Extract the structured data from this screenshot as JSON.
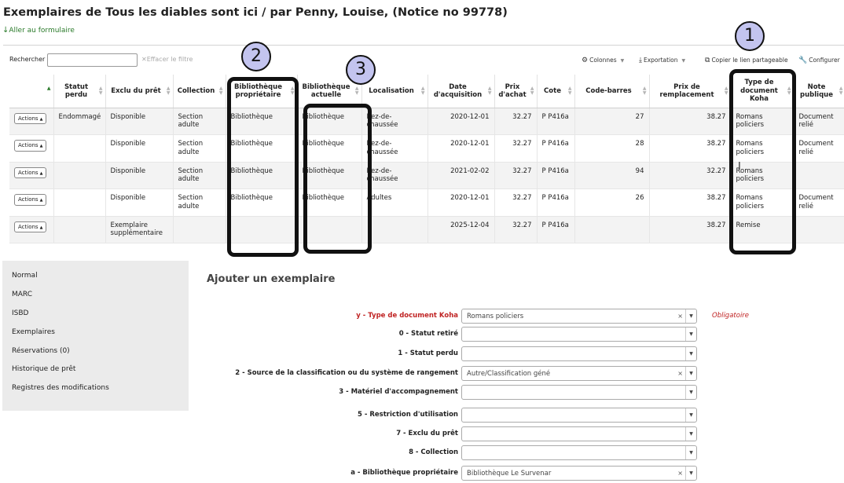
{
  "page_title": "Exemplaires de Tous les diables sont ici / par Penny, Louise, (Notice no 99778)",
  "goto_form": "Aller au formulaire",
  "toolbar": {
    "search_label": "Rechercher :",
    "search_value": "",
    "clear_filter": "Effacer le filtre",
    "columns": "Colonnes",
    "export": "Exportation",
    "copy_link": "Copier le lien partageable",
    "configure": "Configurer"
  },
  "table": {
    "headers": [
      "",
      "Statut perdu",
      "Exclu du prêt",
      "Collection",
      "Bibliothèque propriétaire",
      "Bibliothèque actuelle",
      "Localisation",
      "Date d'acquisition",
      "Prix d'achat",
      "Cote",
      "Code-barres",
      "Prix de remplacement",
      "Type de document Koha",
      "Note publique"
    ],
    "action_label": "Actions",
    "rows": [
      {
        "lost": "Endommagé",
        "notforloan": "Disponible",
        "collection": "Section adulte",
        "homebranch": "Bibliothèque",
        "holdingbranch": "Bibliothèque",
        "location": "Rez-de-chaussée",
        "date": "2020-12-01",
        "price": "32.27",
        "callnumber": "P P416a",
        "barcode": "27",
        "replacement": "38.27",
        "itype": "Romans policiers",
        "note": "Document relié"
      },
      {
        "lost": "",
        "notforloan": "Disponible",
        "collection": "Section adulte",
        "homebranch": "Bibliothèque",
        "holdingbranch": "Bibliothèque",
        "location": "Rez-de-chaussée",
        "date": "2020-12-01",
        "price": "32.27",
        "callnumber": "P P416a",
        "barcode": "28",
        "replacement": "38.27",
        "itype": "Romans policiers",
        "note": "Document relié"
      },
      {
        "lost": "",
        "notforloan": "Disponible",
        "collection": "Section adulte",
        "homebranch": "Bibliothèque",
        "holdingbranch": "Bibliothèque",
        "location": "Rez-de-chaussée",
        "date": "2021-02-02",
        "price": "32.27",
        "callnumber": "P P416a",
        "barcode": "94",
        "replacement": "32.27",
        "itype": "Romans policiers",
        "note": ""
      },
      {
        "lost": "",
        "notforloan": "Disponible",
        "collection": "Section adulte",
        "homebranch": "Bibliothèque",
        "holdingbranch": "Bibliothèque",
        "location": "Adultes",
        "date": "2020-12-01",
        "price": "32.27",
        "callnumber": "P P416a",
        "barcode": "26",
        "replacement": "38.27",
        "itype": "Romans policiers",
        "note": "Document relié"
      },
      {
        "lost": "",
        "notforloan": "Exemplaire supplémentaire",
        "collection": "",
        "homebranch": "",
        "holdingbranch": "",
        "location": "",
        "date": "2025-12-04",
        "price": "32.27",
        "callnumber": "P P416a",
        "barcode": "",
        "replacement": "38.27",
        "itype": "Remise",
        "note": ""
      }
    ]
  },
  "callouts": [
    "1",
    "2",
    "3"
  ],
  "side_menu": [
    "Normal",
    "MARC",
    "ISBD",
    "Exemplaires",
    "Réservations (0)",
    "Historique de prêt",
    "Registres des modifications"
  ],
  "form": {
    "title": "Ajouter un exemplaire",
    "mandatory_label": "Obligatoire",
    "fields": [
      {
        "label": "y - Type de document Koha",
        "value": "Romans policiers",
        "required": true
      },
      {
        "label": "0 - Statut retiré",
        "value": "",
        "required": false
      },
      {
        "label": "1 - Statut perdu",
        "value": "",
        "required": false
      },
      {
        "label": "2 - Source de la classification ou du système de rangement",
        "value": "Autre/Classification géné",
        "required": false
      },
      {
        "label": "3 - Matériel d'accompagnement",
        "value": "",
        "required": false
      },
      {
        "label": "5 - Restriction d'utilisation",
        "value": "",
        "required": false
      },
      {
        "label": "7 - Exclu du prêt",
        "value": "",
        "required": false
      },
      {
        "label": "8 - Collection",
        "value": "",
        "required": false
      },
      {
        "label": "a - Bibliothèque propriétaire",
        "value": "Bibliothèque Le Survenar",
        "required": false
      }
    ]
  },
  "colors": {
    "link_green": "#2a7a2a",
    "required_red": "#c02424",
    "callout_fill": "#c3c4ef"
  }
}
